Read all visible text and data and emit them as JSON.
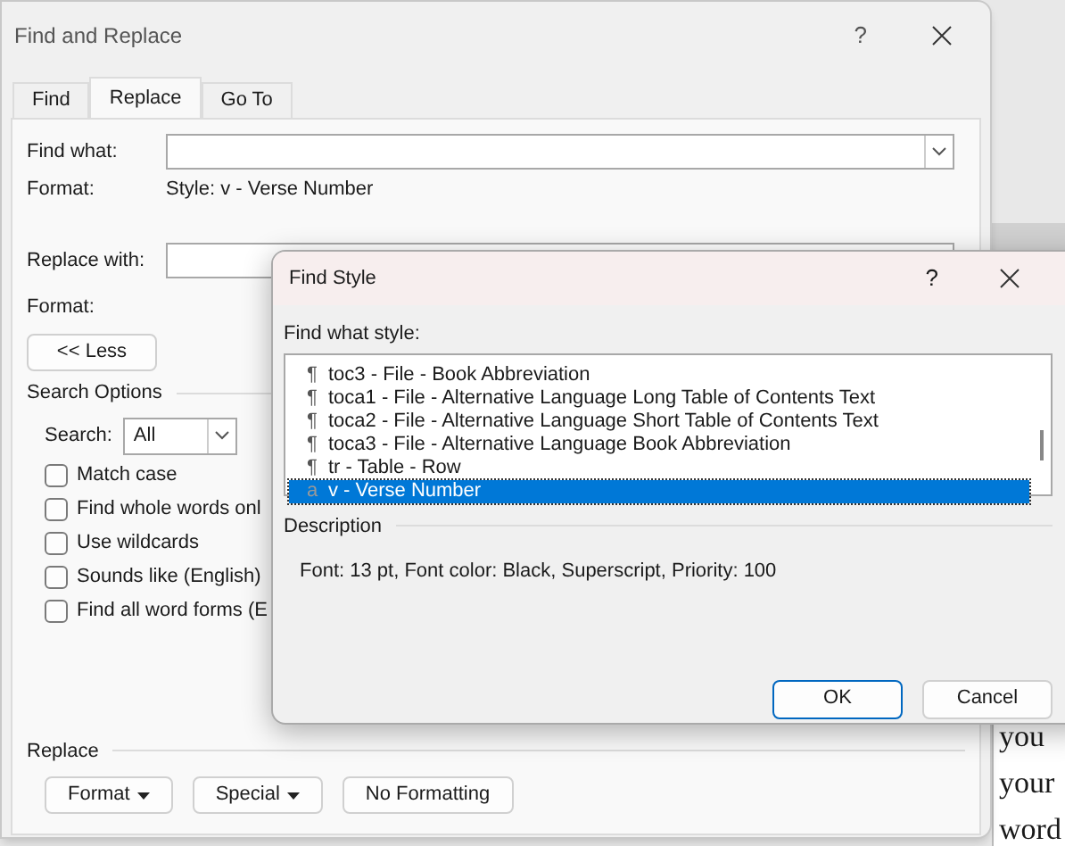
{
  "document": {
    "lines": [
      "you",
      "your",
      "word"
    ]
  },
  "find_replace": {
    "title": "Find and Replace",
    "help": "?",
    "tabs": [
      {
        "label": "Find",
        "selected": false
      },
      {
        "label": "Replace",
        "selected": true
      },
      {
        "label": "Go To",
        "selected": false
      }
    ],
    "find_what": {
      "label": "Find what:"
    },
    "find_format": {
      "label": "Format:",
      "value": "Style: v - Verse Number"
    },
    "replace_with": {
      "label": "Replace with:"
    },
    "replace_format": {
      "label": "Format:"
    },
    "less_button": "<< Less",
    "search_options": {
      "heading": "Search Options",
      "search_label": "Search:",
      "search_value": "All",
      "checkboxes": [
        {
          "label": "Match case",
          "checked": false
        },
        {
          "label": "Find whole words onl",
          "checked": false
        },
        {
          "label": "Use wildcards",
          "checked": false
        },
        {
          "label": "Sounds like (English)",
          "checked": false
        },
        {
          "label": "Find all word forms (E",
          "checked": false
        }
      ]
    },
    "replace_heading": "Replace",
    "buttons": [
      {
        "label": "Format",
        "dropdown": true
      },
      {
        "label": "Special",
        "dropdown": true
      },
      {
        "label": "No Formatting",
        "dropdown": false
      }
    ]
  },
  "find_style": {
    "title": "Find Style",
    "help": "?",
    "list_label": "Find what style:",
    "styles": [
      {
        "glyph": "¶",
        "name": "toc3 - File - Book Abbreviation",
        "selected": false
      },
      {
        "glyph": "¶",
        "name": "toca1 - File - Alternative Language Long Table of Contents Text",
        "selected": false
      },
      {
        "glyph": "¶",
        "name": "toca2 - File - Alternative Language Short Table of Contents Text",
        "selected": false
      },
      {
        "glyph": "¶",
        "name": "toca3 - File - Alternative Language Book Abbreviation",
        "selected": false
      },
      {
        "glyph": "¶",
        "name": "tr - Table - Row",
        "selected": false
      },
      {
        "glyph": "a",
        "name": "v - Verse Number",
        "selected": true
      }
    ],
    "description_heading": "Description",
    "description": "Font: 13 pt, Font color: Black, Superscript, Priority: 100",
    "buttons": [
      {
        "label": "OK",
        "default": true
      },
      {
        "label": "Cancel",
        "default": false
      }
    ]
  }
}
